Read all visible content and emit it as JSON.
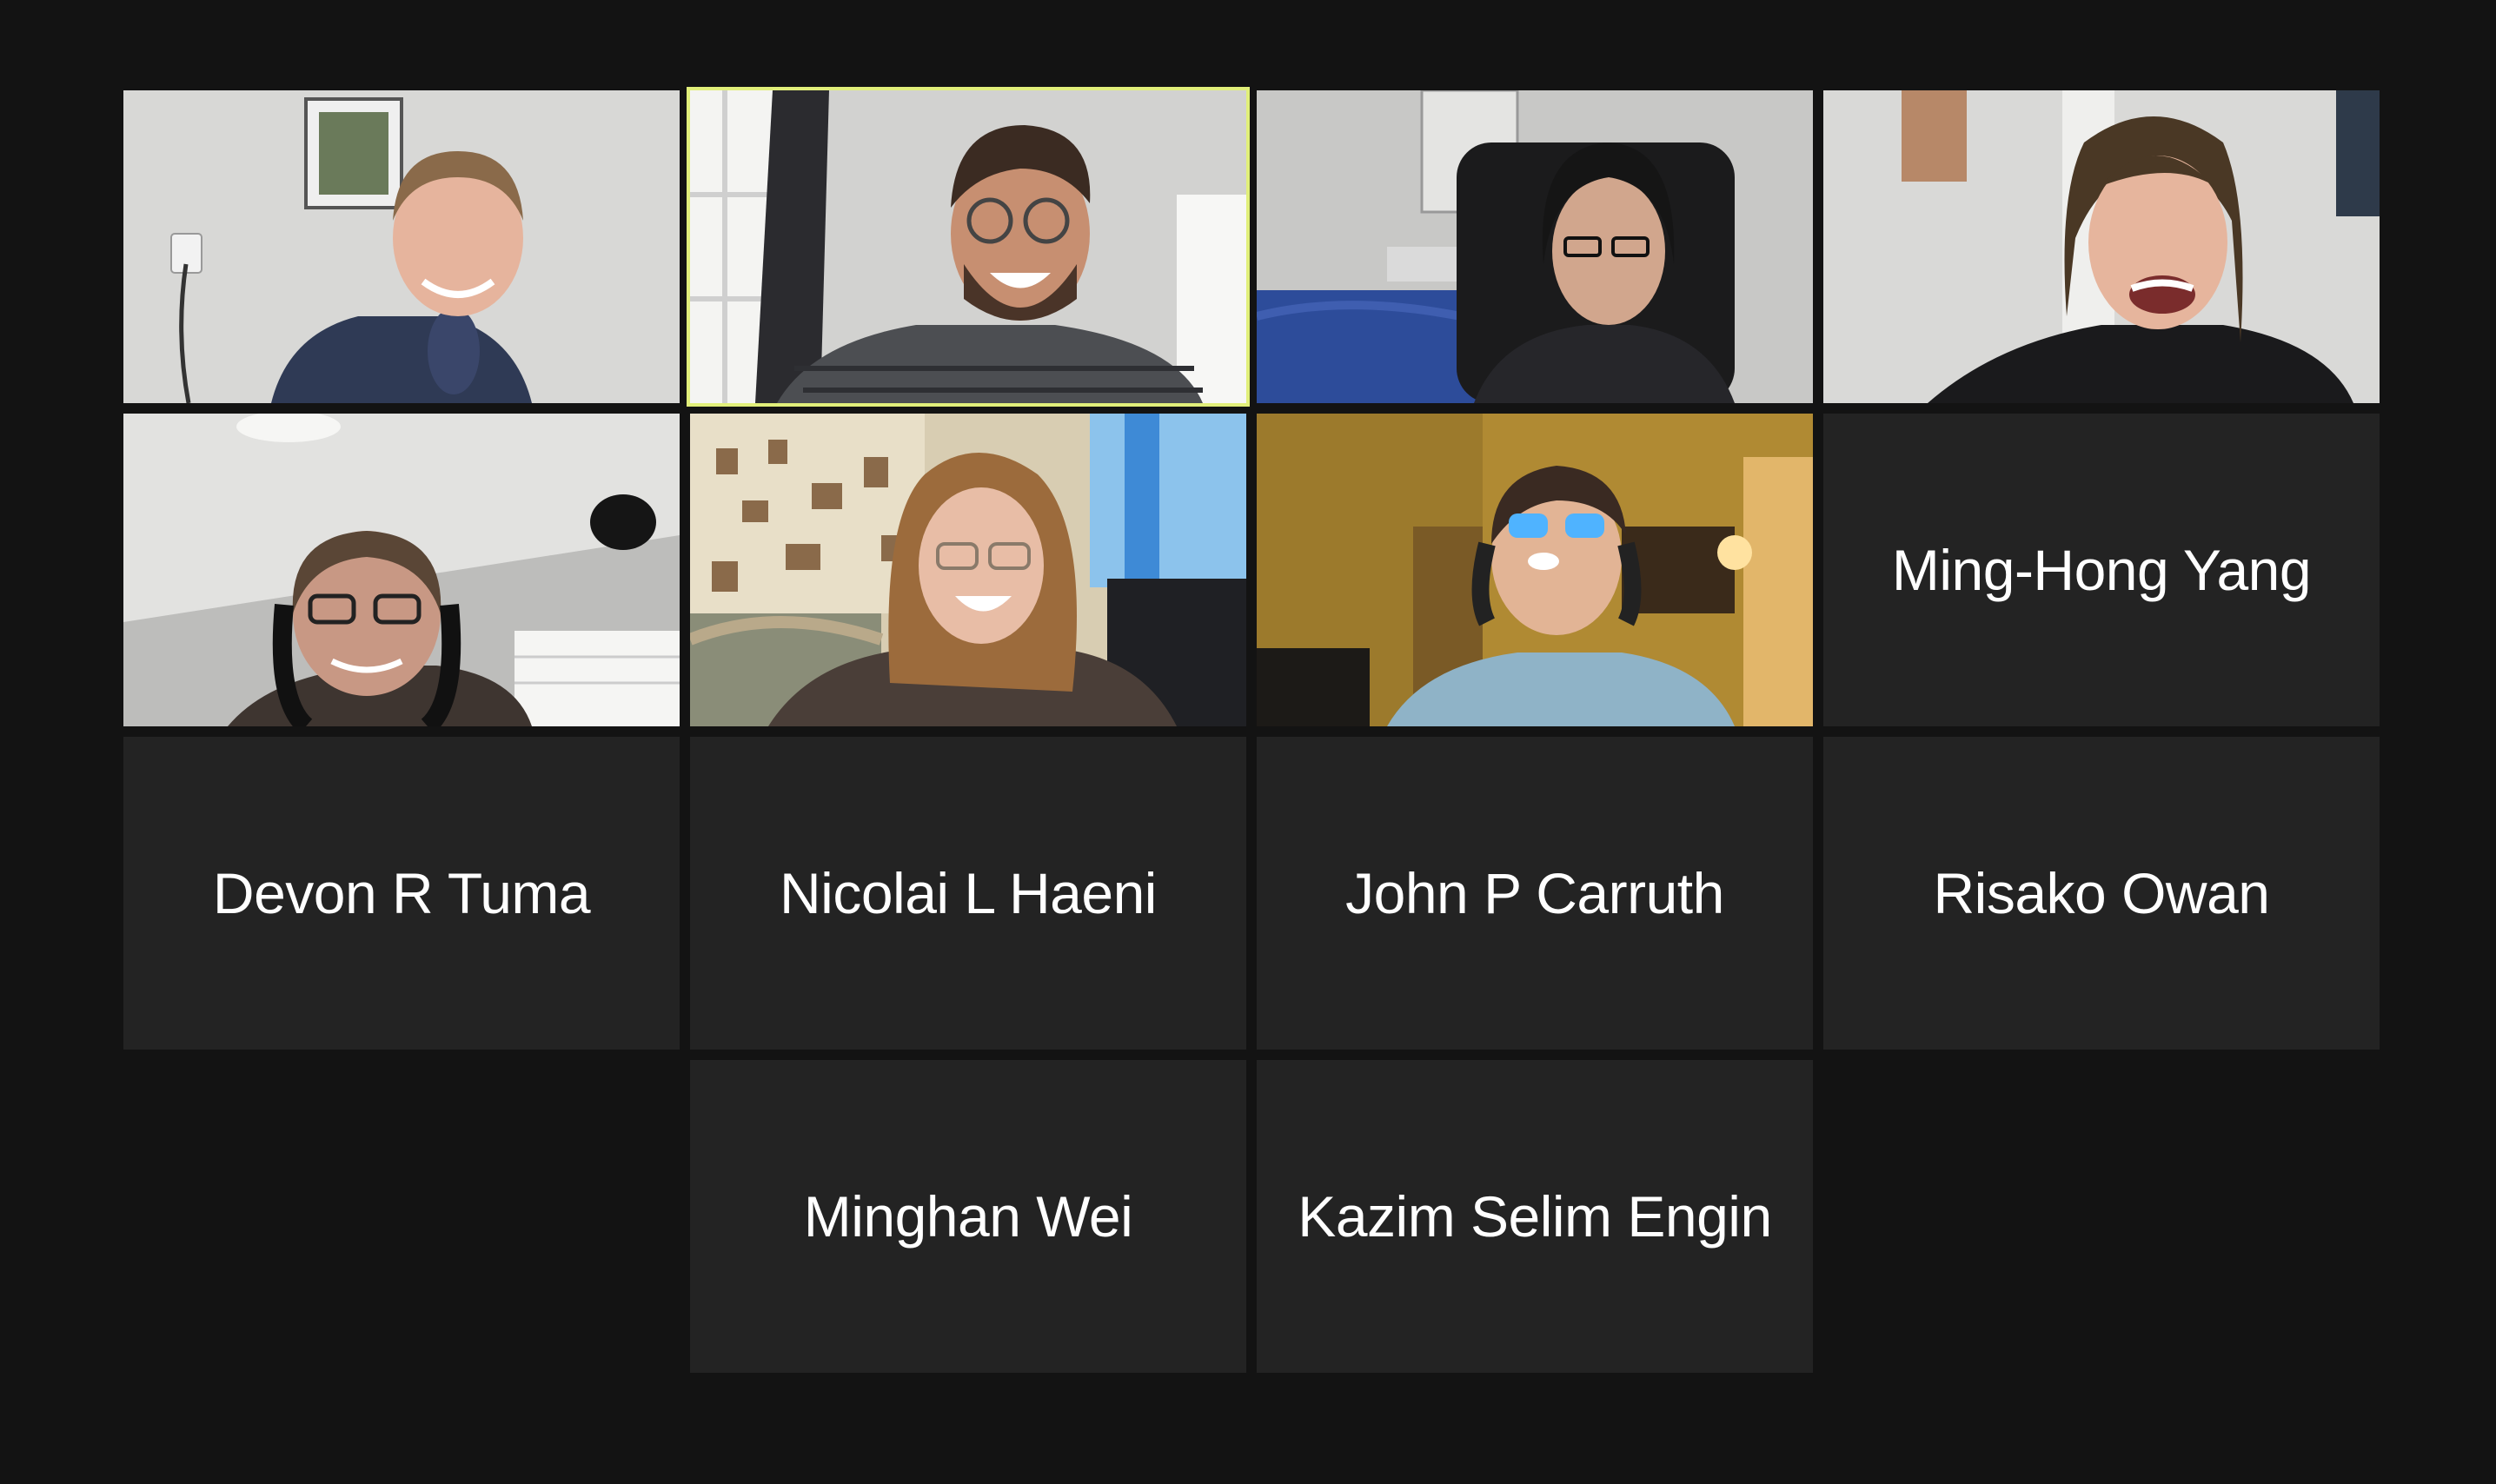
{
  "meeting": {
    "view": "gallery",
    "active_speaker_index": 1
  },
  "participants": [
    {
      "name": "",
      "video_on": true,
      "scene": "woman-blue-hoodie-white-room"
    },
    {
      "name": "",
      "video_on": true,
      "scene": "man-glasses-laughing-window",
      "active_speaker": true
    },
    {
      "name": "",
      "video_on": true,
      "scene": "person-glasses-gaming-chair-bedroom"
    },
    {
      "name": "",
      "video_on": true,
      "scene": "man-long-hair-laughing"
    },
    {
      "name": "",
      "video_on": true,
      "scene": "man-headphones-microphone"
    },
    {
      "name": "",
      "video_on": true,
      "scene": "woman-glasses-curly-hair-couch"
    },
    {
      "name": "",
      "video_on": true,
      "scene": "person-headphones-blue-glasses-warm-room"
    },
    {
      "name": "Ming-Hong Yang",
      "video_on": false
    },
    {
      "name": "Devon R Tuma",
      "video_on": false
    },
    {
      "name": "Nicolai L Haeni",
      "video_on": false
    },
    {
      "name": "John P Carruth",
      "video_on": false
    },
    {
      "name": "Risako Owan",
      "video_on": false
    },
    {
      "name": "Minghan Wei",
      "video_on": false
    },
    {
      "name": "Kazim Selim Engin",
      "video_on": false
    }
  ],
  "colors": {
    "background": "#131313",
    "tile": "#232323",
    "active_border": "#e1ef7a",
    "name_text": "#ffffff"
  }
}
